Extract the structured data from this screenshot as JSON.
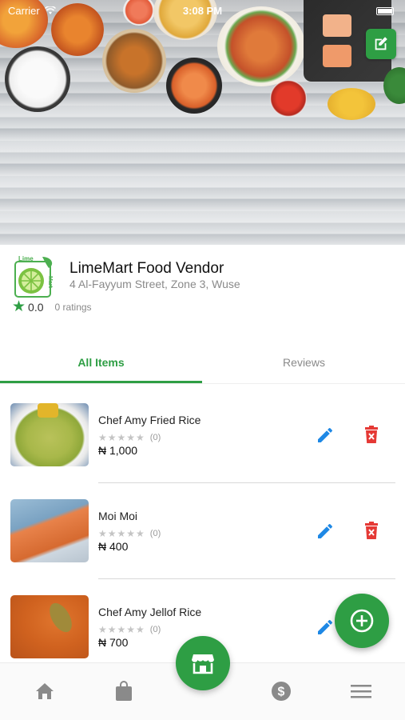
{
  "status_bar": {
    "carrier": "Carrier",
    "time": "3:08 PM"
  },
  "vendor": {
    "name": "LimeMart Food Vendor",
    "address": "4 Al-Fayyum Street, Zone 3, Wuse",
    "rating": "0.0",
    "ratings_count": "0 ratings",
    "logo_top_text": "Lime",
    "logo_side_text": "Mart"
  },
  "tabs": [
    {
      "label": "All Items",
      "active": true
    },
    {
      "label": "Reviews",
      "active": false
    }
  ],
  "items": [
    {
      "name": "Chef Amy Fried Rice",
      "stars": "★★★★★",
      "review_count": "(0)",
      "price": "₦ 1,000",
      "rating": 0
    },
    {
      "name": "Moi Moi",
      "stars": "★★★★★",
      "review_count": "(0)",
      "price": "₦ 400",
      "rating": 0
    },
    {
      "name": "Chef Amy Jellof Rice",
      "stars": "★★★★★",
      "review_count": "(0)",
      "price": "₦ 700",
      "rating": 0
    }
  ],
  "icons": {
    "edit_cover": "edit-square-icon",
    "edit_item": "pencil-icon",
    "delete_item": "trash-icon",
    "add": "plus-circle-icon",
    "store": "storefront-icon",
    "nav": [
      "home-icon",
      "shopping-bag-icon",
      "dollar-circle-icon",
      "menu-icon"
    ]
  },
  "colors": {
    "brand_green": "#2e9e44",
    "edit_blue": "#1e88e5",
    "delete_red": "#e53935",
    "nav_icon_grey": "#8a8a8a"
  }
}
